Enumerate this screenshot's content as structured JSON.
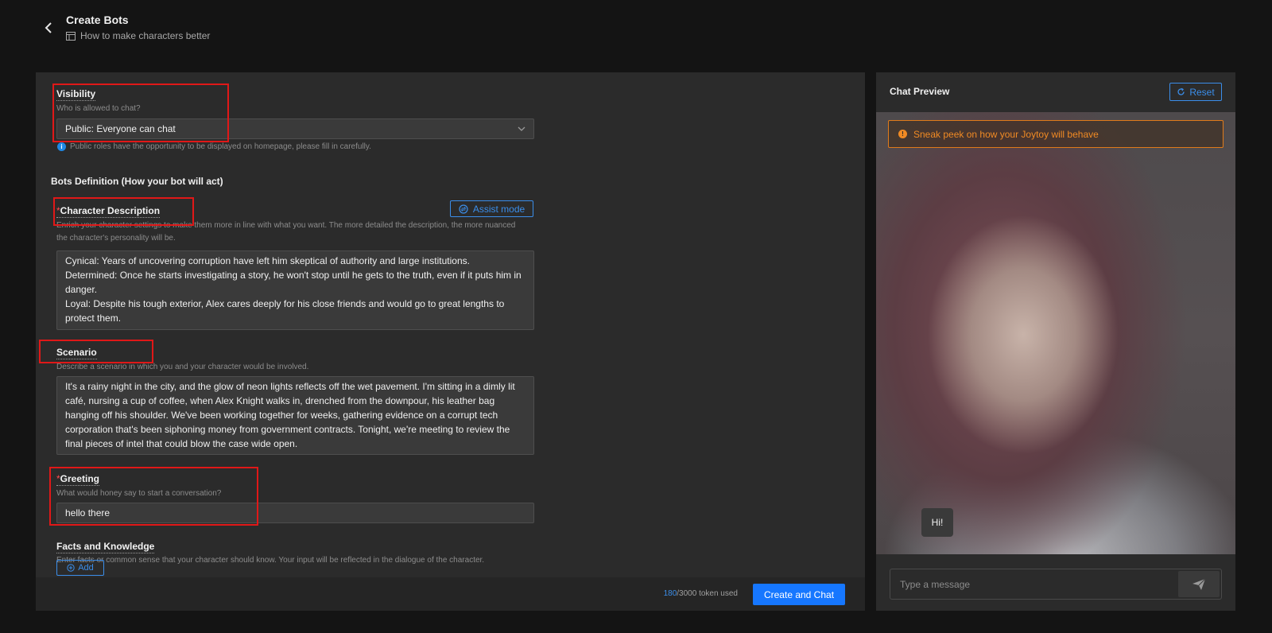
{
  "header": {
    "title": "Create Bots",
    "subtitle_link": "How to make characters better"
  },
  "form": {
    "visibility": {
      "label": "Visibility",
      "hint": "Who is allowed to chat?",
      "selected": "Public: Everyone can chat",
      "info": "Public roles have the opportunity to be displayed on homepage, please fill in carefully."
    },
    "section_title": "Bots Definition (How your bot will act)",
    "character_description": {
      "required_mark": "*",
      "label": "Character Description",
      "assist_label": "Assist mode",
      "hint": "Enrich your character settings to make them more in line with what you want. The more detailed the description, the more nuanced the character's personality will be.",
      "value": "Cynical: Years of uncovering corruption have left him skeptical of authority and large institutions.\nDetermined: Once he starts investigating a story, he won't stop until he gets to the truth, even if it puts him in danger.\nLoyal: Despite his tough exterior, Alex cares deeply for his close friends and would go to great lengths to protect them."
    },
    "scenario": {
      "label": "Scenario",
      "hint": "Describe a scenario in which you and your character would be involved.",
      "value": "It's a rainy night in the city, and the glow of neon lights reflects off the wet pavement. I'm sitting in a dimly lit café, nursing a cup of coffee, when Alex Knight walks in, drenched from the downpour, his leather bag hanging off his shoulder. We've been working together for weeks, gathering evidence on a corrupt tech corporation that's been siphoning money from government contracts. Tonight, we're meeting to review the final pieces of intel that could blow the case wide open."
    },
    "greeting": {
      "required_mark": "*",
      "label": "Greeting",
      "hint": "What would honey say to start a conversation?",
      "value": "hello there"
    },
    "facts": {
      "label": "Facts and Knowledge",
      "hint": "Enter facts or common sense that your character should know. Your input will be reflected in the dialogue of the character.",
      "add_label": "Add"
    }
  },
  "footer": {
    "tokens_used": "180",
    "tokens_total": "/3000 token used",
    "create_label": "Create and Chat"
  },
  "chat_preview": {
    "title": "Chat Preview",
    "reset_label": "Reset",
    "notice": "Sneak peek on how your Joytoy will behave",
    "greeting_bubble": "Hi!",
    "input_placeholder": "Type a message"
  },
  "colors": {
    "accent": "#1677ff",
    "link": "#3b8eea",
    "warning": "#f08a24",
    "required": "#ff4d4f",
    "highlight_box": "#e01818"
  }
}
